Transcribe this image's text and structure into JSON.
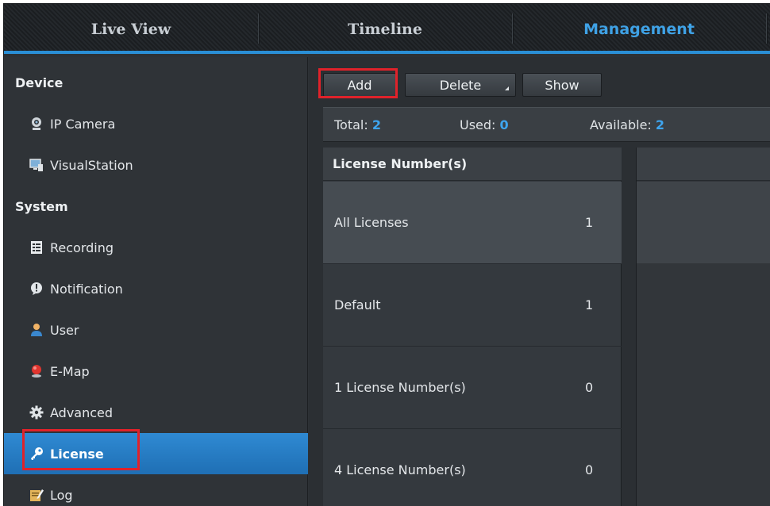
{
  "topnav": {
    "tabs": [
      {
        "label": "Live View",
        "active": false
      },
      {
        "label": "Timeline",
        "active": false
      },
      {
        "label": "Management",
        "active": true
      }
    ]
  },
  "sidebar": {
    "sections": [
      {
        "header": "Device",
        "items": [
          {
            "label": "IP Camera",
            "icon": "camera-icon"
          },
          {
            "label": "VisualStation",
            "icon": "visualstation-icon"
          }
        ]
      },
      {
        "header": "System",
        "items": [
          {
            "label": "Recording",
            "icon": "recording-icon"
          },
          {
            "label": "Notification",
            "icon": "notification-icon"
          },
          {
            "label": "User",
            "icon": "user-icon"
          },
          {
            "label": "E-Map",
            "icon": "map-pin-icon"
          },
          {
            "label": "Advanced",
            "icon": "gear-icon"
          },
          {
            "label": "License",
            "icon": "key-icon",
            "selected": true
          },
          {
            "label": "Log",
            "icon": "log-icon"
          }
        ]
      }
    ]
  },
  "toolbar": {
    "add_label": "Add",
    "delete_label": "Delete",
    "show_label": "Show"
  },
  "stats": {
    "total_label": "Total:",
    "total_value": "2",
    "used_label": "Used:",
    "used_value": "0",
    "available_label": "Available:",
    "available_value": "2"
  },
  "license_list": {
    "header": "License Number(s)",
    "rows": [
      {
        "name": "All Licenses",
        "count": "1",
        "selected": true
      },
      {
        "name": "Default",
        "count": "1"
      },
      {
        "name": "1 License Number(s)",
        "count": "0"
      },
      {
        "name": "4 License Number(s)",
        "count": "0"
      }
    ]
  },
  "colors": {
    "accent": "#3fa2e6",
    "selected_row": "#2f8ad3",
    "highlight_box": "#e0222a"
  }
}
